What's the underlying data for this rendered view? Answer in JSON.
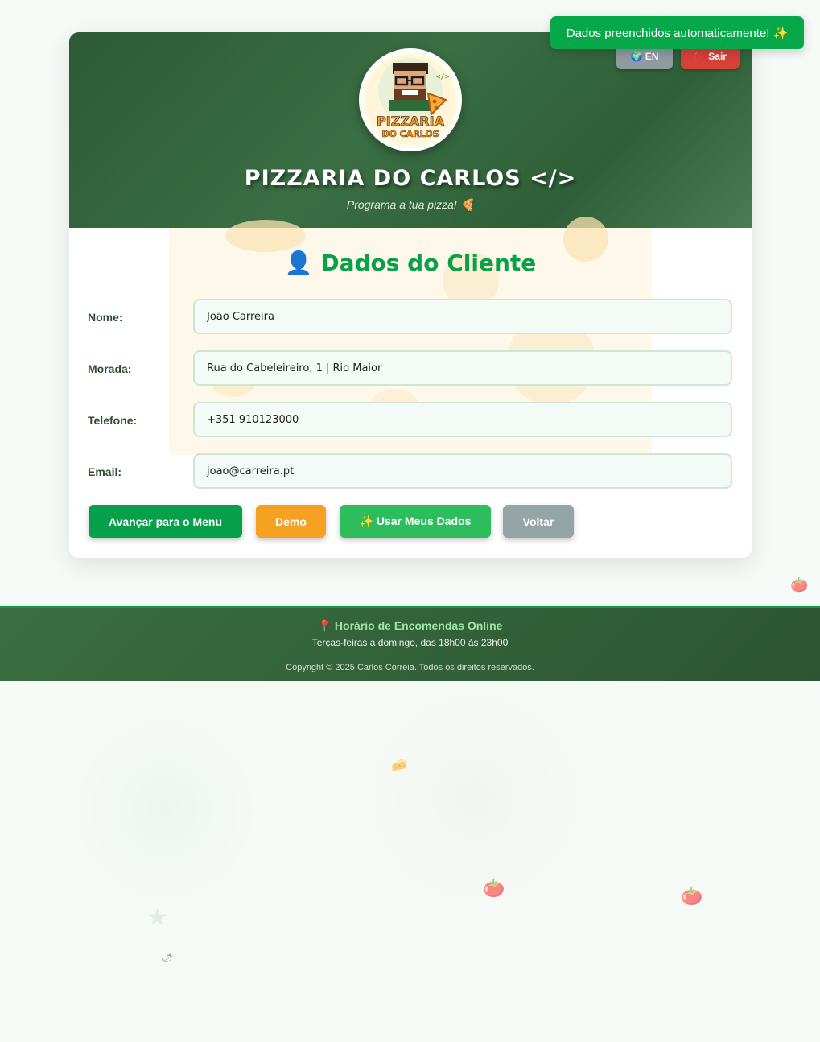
{
  "toast": {
    "message": "Dados preenchidos automaticamente! ✨"
  },
  "header": {
    "title": "PIZZARIA DO CARLOS </>",
    "subtitle": "Programa a tua pizza! 🍕",
    "logo_text_top": "PIZZARIA",
    "logo_text_bottom": "DO CARLOS",
    "lang_button": "🌍 EN",
    "exit_button": "🚫 Sair"
  },
  "form": {
    "title": "👤 Dados do Cliente",
    "fields": [
      {
        "label": "Nome:",
        "value": "João Carreira"
      },
      {
        "label": "Morada:",
        "value": "Rua do Cabeleireiro, 1 | Rio Maior"
      },
      {
        "label": "Telefone:",
        "value": "+351 910123000"
      },
      {
        "label": "Email:",
        "value": "joao@carreira.pt"
      }
    ]
  },
  "actions": {
    "next": "Avançar para o Menu",
    "demo": "Demo",
    "use_my_data": "✨ Usar Meus Dados",
    "back": "Voltar"
  },
  "footer": {
    "title": "📍 Horário de Encomendas Online",
    "hours": "Terças-feiras a domingo, das 18h00 às 23h00",
    "copyright": "Copyright © 2025 Carlos Correia. Todos os direitos reservados."
  },
  "colors": {
    "brand_green": "#2c5a34",
    "accent_green": "#08a048",
    "demo_orange": "#f5a122",
    "exit_red": "#d6413a"
  }
}
